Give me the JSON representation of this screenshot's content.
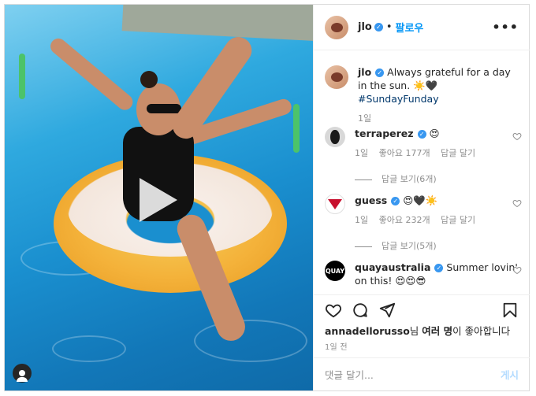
{
  "post": {
    "username": "jlo",
    "follow_label": "팔로우",
    "caption": "Always grateful for a day in the sun. ☀️🖤 #SundayFunday",
    "caption_time": "1일",
    "likes_user": "annadellorusso",
    "likes_suffix": "님 ",
    "likes_bold": "여러 명",
    "likes_end": "이 좋아합니다",
    "timestamp": "1일 전",
    "add_comment_placeholder": "댓글 달기...",
    "post_button": "게시"
  },
  "comments": [
    {
      "username": "terraperez",
      "text": "😍",
      "time": "1일",
      "likes": "좋아요 177개",
      "reply": "답글 달기",
      "view_replies": "답글 보기(6개)"
    },
    {
      "username": "guess",
      "text": "😍🖤☀️",
      "time": "1일",
      "likes": "좋아요 232개",
      "reply": "답글 달기",
      "view_replies": "답글 보기(5개)"
    },
    {
      "username": "quayaustralia",
      "text": "Summer lovin' on this! 😍😍😎"
    }
  ],
  "avatars": {
    "quay_text": "QUAY"
  },
  "icons": [
    "heart-icon",
    "comment-icon",
    "share-icon",
    "bookmark-icon",
    "more-icon",
    "play-icon",
    "user-tag-icon"
  ],
  "colors": {
    "link": "#0095f6",
    "verified": "#3897f0",
    "muted": "#8e8e8e"
  }
}
